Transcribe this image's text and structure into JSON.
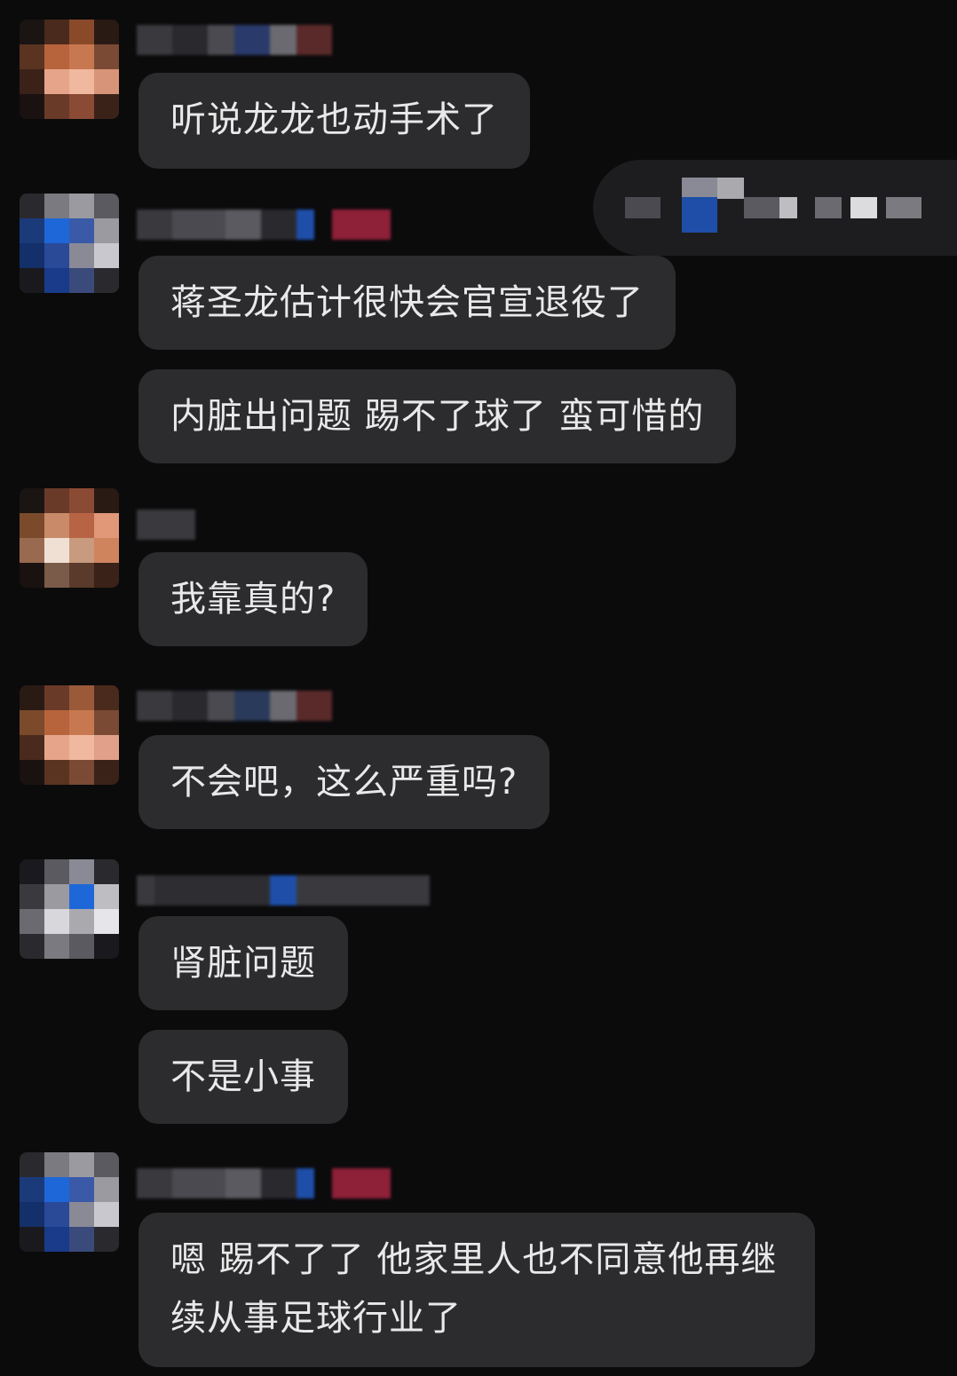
{
  "messages": [
    {
      "text": "听说龙龙也动手术了"
    },
    {
      "text": "蒋圣龙估计很快会官宣退役了"
    },
    {
      "text": "内脏出问题 踢不了球了 蛮可惜的"
    },
    {
      "text": "我靠真的?"
    },
    {
      "text": "不会吧，这么严重吗?"
    },
    {
      "text": "肾脏问题"
    },
    {
      "text": "不是小事"
    },
    {
      "text": "嗯 踢不了了 他家里人也不同意他再继续从事足球行业了"
    }
  ],
  "colors": {
    "background": "#0b0b0c",
    "bubble": "#2c2c2e",
    "text": "#e9e9ea",
    "badge_red": "#8e2038",
    "accent_blue": "#1e67d8"
  }
}
